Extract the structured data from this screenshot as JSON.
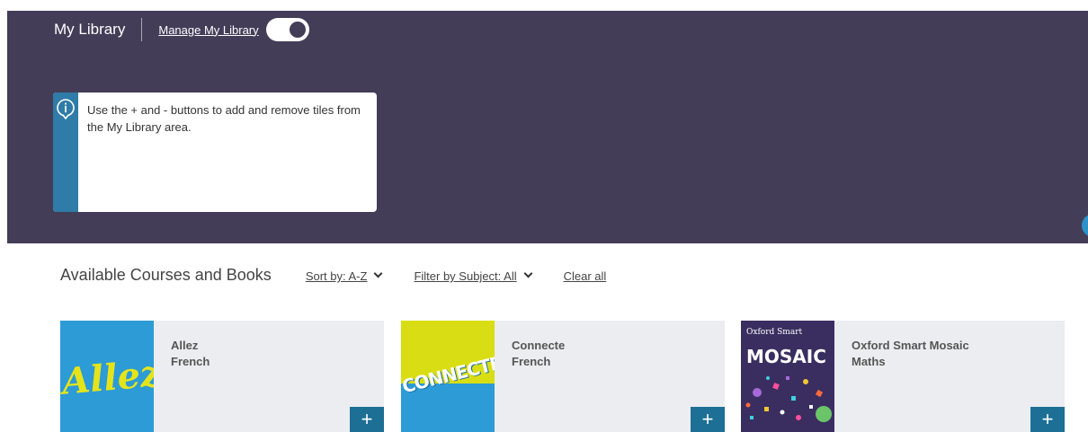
{
  "header": {
    "title": "My Library",
    "manage_label": "Manage My Library",
    "toggle_on": true
  },
  "info_box": {
    "icon": "info-icon",
    "message": "Use the + and - buttons to add and remove tiles from the My Library area."
  },
  "filters": {
    "heading": "Available Courses and Books",
    "sort_label": "Sort by: A-Z",
    "filter_label": "Filter by Subject: All",
    "clear_label": "Clear all"
  },
  "cards": [
    {
      "cover_text": "Allez",
      "title": "Allez",
      "subject": "French",
      "add_label": "+"
    },
    {
      "cover_text": "CONNECTE",
      "title": "Connecte",
      "subject": "French",
      "add_label": "+"
    },
    {
      "cover_brand": "Oxford Smart",
      "cover_text": "MOSAIC",
      "title": "Oxford Smart Mosaic",
      "subject": "Maths",
      "add_label": "+"
    }
  ],
  "colors": {
    "hero_bg": "#433d58",
    "info_accent": "#2e7ca7",
    "add_button": "#1d6f95",
    "card_bg": "#ecedf1"
  }
}
